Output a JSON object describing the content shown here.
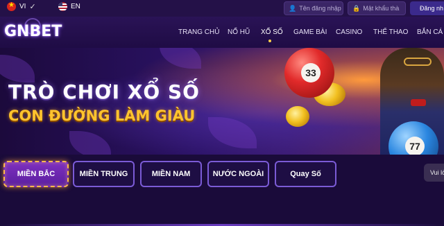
{
  "topbar": {
    "languages": [
      {
        "code": "VI",
        "icon": "vietnam-flag-icon",
        "selected": true
      },
      {
        "code": "EN",
        "icon": "usa-flag-icon",
        "selected": false
      }
    ],
    "username_placeholder": "Tên đăng nhập",
    "password_placeholder": "Mật khẩu thà",
    "login_label": "Đăng nh"
  },
  "header": {
    "logo": "GNBET",
    "nav": [
      {
        "label": "TRANG CHỦ",
        "active": false
      },
      {
        "label": "NỔ HŨ",
        "active": false
      },
      {
        "label": "XỔ SỐ",
        "active": true
      },
      {
        "label": "GAME BÀI",
        "active": false
      },
      {
        "label": "CASINO",
        "active": false
      },
      {
        "label": "THỂ THAO",
        "active": false
      },
      {
        "label": "BẮN CÁ",
        "active": false
      }
    ]
  },
  "banner": {
    "title": "TRÒ CHƠI XỔ SỐ",
    "subtitle": "CON ĐƯỜNG LÀM GIÀU",
    "ball_red_number": "33",
    "ball_blue_number": "77"
  },
  "tabs": [
    {
      "label": "MIỀN BẮC",
      "active": true
    },
    {
      "label": "MIỀN TRUNG",
      "active": false
    },
    {
      "label": "MIỀN NAM",
      "active": false
    },
    {
      "label": "NƯỚC NGOÀI",
      "active": false
    },
    {
      "label": "Quay Số",
      "active": false
    }
  ],
  "tooltip": "Vui lò",
  "colors": {
    "background": "#1a0b3a",
    "accent": "#7b5bd6",
    "highlight": "#ffc42e"
  }
}
